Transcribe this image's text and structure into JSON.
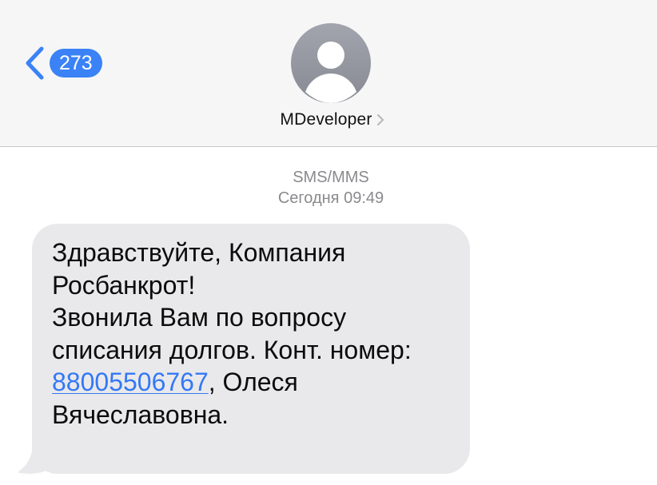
{
  "header": {
    "unread_count": "273",
    "contact_name": "MDeveloper",
    "icons": {
      "back": "chevron-left-icon",
      "contact_detail": "chevron-right-icon",
      "avatar": "person-icon"
    }
  },
  "conversation": {
    "service": "SMS/MMS",
    "timestamp": "Сегодня 09:49",
    "message": {
      "before_link": "Здравствуйте, Компания\nРосбанкрот!\nЗвонила Вам по вопросу\nсписания долгов. Конт. номер:\n",
      "phone": "88005506767",
      "after_link": ", Олеся\nВячеславовна."
    }
  },
  "colors": {
    "accent": "#3a82f6",
    "link": "#3478f6",
    "header_background": "#f6f6f6",
    "bubble_background": "#e9e9eb",
    "secondary_text": "#8a8a8e"
  }
}
